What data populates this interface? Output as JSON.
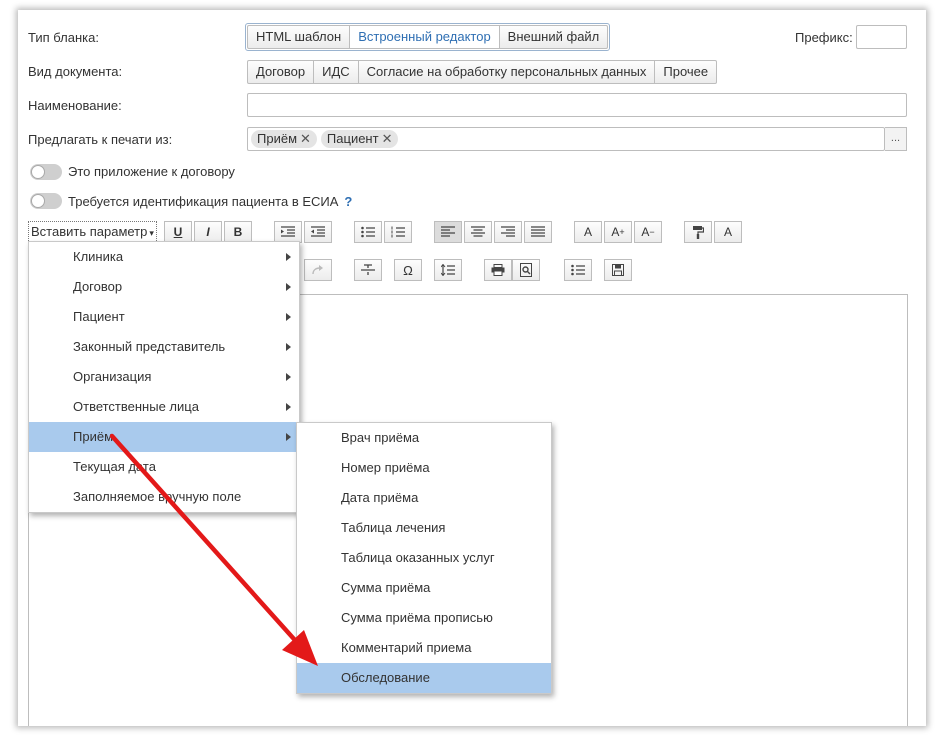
{
  "form": {
    "blank_type_label": "Тип бланка:",
    "blank_type_options": [
      "HTML шаблон",
      "Встроенный редактор",
      "Внешний файл"
    ],
    "prefix_label": "Префикс:",
    "prefix_value": "",
    "doc_type_label": "Вид документа:",
    "doc_type_options": [
      "Договор",
      "ИДС",
      "Согласие на обработку персональных данных",
      "Прочее"
    ],
    "name_label": "Наименование:",
    "name_value": "",
    "print_from_label": "Предлагать к печати из:",
    "print_from_tags": [
      "Приём",
      "Пациент"
    ],
    "more_button": "...",
    "toggle_contract_label": "Это приложение к договору",
    "toggle_esia_label": "Требуется идентификация пациента в ЕСИА",
    "help_mark": "?"
  },
  "toolbar": {
    "insert_param_label": "Вставить параметр",
    "underline": "U",
    "italic": "I",
    "bold": "B",
    "font_a": "A",
    "font_a_plus": "A",
    "font_a_minus": "A",
    "clear_a": "A",
    "omega": "Ω"
  },
  "menu": {
    "items": [
      {
        "label": "Клиника",
        "submenu": true
      },
      {
        "label": "Договор",
        "submenu": true
      },
      {
        "label": "Пациент",
        "submenu": true
      },
      {
        "label": "Законный представитель",
        "submenu": true
      },
      {
        "label": "Организация",
        "submenu": true
      },
      {
        "label": "Ответственные лица",
        "submenu": true
      },
      {
        "label": "Приём",
        "submenu": true,
        "highlighted": true
      },
      {
        "label": "Текущая дата",
        "submenu": false
      },
      {
        "label": "Заполняемое вручную поле",
        "submenu": false
      }
    ]
  },
  "submenu": {
    "items": [
      {
        "label": "Врач приёма"
      },
      {
        "label": "Номер приёма"
      },
      {
        "label": "Дата приёма"
      },
      {
        "label": "Таблица лечения"
      },
      {
        "label": "Таблица оказанных услуг"
      },
      {
        "label": "Сумма приёма"
      },
      {
        "label": "Сумма приёма прописью"
      },
      {
        "label": "Комментарий приема"
      },
      {
        "label": "Обследование",
        "highlighted": true
      }
    ]
  },
  "colors": {
    "accent_text": "#2f6fb3",
    "highlight": "#a9caed",
    "annotation_red": "#e31919"
  }
}
